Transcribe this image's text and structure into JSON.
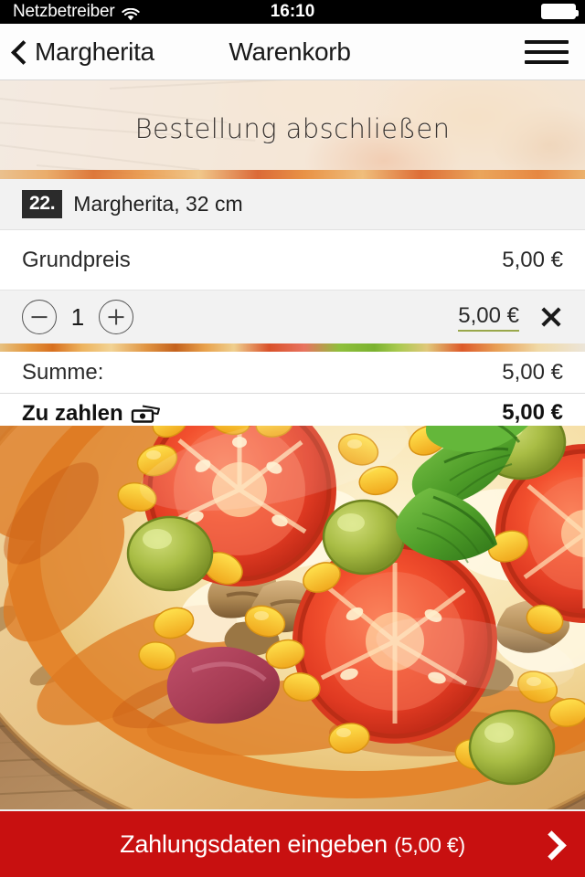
{
  "statusbar": {
    "carrier": "Netzbetreiber",
    "wifi_icon": "wifi-icon",
    "time": "16:10",
    "battery_icon": "battery-full-icon"
  },
  "navbar": {
    "back_icon": "chevron-left-icon",
    "back_label": "Margherita",
    "title": "Warenkorb",
    "menu_icon": "hamburger-menu-icon"
  },
  "banner": {
    "title": "Bestellung abschließen"
  },
  "cart": {
    "item": {
      "number_badge": "22.",
      "name": "Margherita, 32 cm"
    },
    "base_price": {
      "label": "Grundpreis",
      "value": "5,00 €"
    },
    "quantity_row": {
      "decrement_icon": "minus-circle-icon",
      "quantity": "1",
      "increment_icon": "plus-circle-icon",
      "line_total": "5,00 €",
      "remove_icon": "close-x-icon"
    },
    "summary": {
      "label": "Summe:",
      "value": "5,00 €"
    },
    "to_pay": {
      "label": "Zu zahlen",
      "icon": "cash-banknote-icon",
      "value": "5,00 €"
    }
  },
  "photo": {
    "alt": "pizza-photo"
  },
  "cta": {
    "label": "Zahlungsdaten eingeben",
    "amount": "(5,00 €)",
    "arrow_icon": "chevron-right-icon"
  },
  "colors": {
    "accent_red": "#c81010",
    "badge_dark": "#2b2b2b",
    "underline_olive": "#9aa84b",
    "row_alt_gray": "#f2f2f2"
  }
}
